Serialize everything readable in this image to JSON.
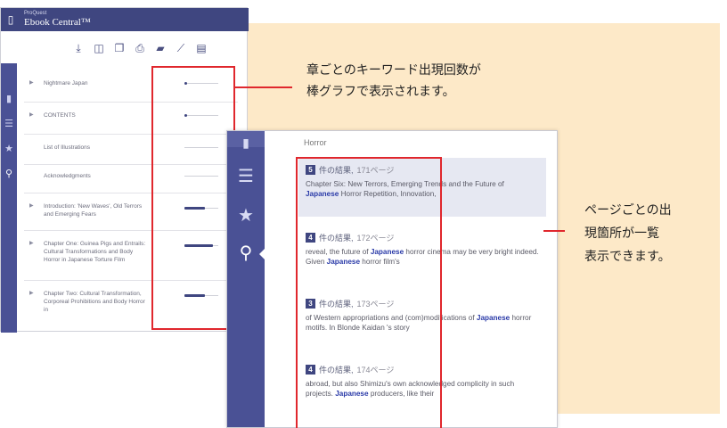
{
  "colors": {
    "accent": "#3f4680",
    "sidebar": "#4a5195",
    "highlight_red": "#e0272d",
    "panel_bg": "#fde9c8",
    "keyword": "#2a3aa8"
  },
  "back_window": {
    "brand_small": "ProQuest",
    "brand": "Ebook Central™",
    "toolbar": [
      "download-icon",
      "book-icon",
      "copy-icon",
      "print-icon",
      "bookmark-icon",
      "link-icon",
      "note-icon"
    ],
    "sidebar_icons": [
      "contents-icon",
      "list-icon",
      "star-icon",
      "search-icon"
    ],
    "rows": [
      {
        "label": "Nightmare Japan",
        "arrow": "▶",
        "bar": "dot"
      },
      {
        "label": "CONTENTS",
        "arrow": "▶",
        "bar": "dot"
      },
      {
        "label": "List of Illustrations",
        "arrow": "",
        "bar": "none"
      },
      {
        "label": "Acknowledgments",
        "arrow": "",
        "bar": "none"
      },
      {
        "label": "Introduction: 'New Waves', Old Terrors and Emerging Fears",
        "arrow": "▶",
        "bar": 0.6
      },
      {
        "label": "Chapter One: Guinea Pigs and Entrails: Cultural Transformations and Body Horror in Japanese Torture Film",
        "arrow": "▶",
        "bar": 0.85
      },
      {
        "label": "Chapter Two: Cultural Transformation, Corporeal Prohibitions and Body Horror in",
        "arrow": "▶",
        "bar": 0.6
      }
    ]
  },
  "front_window": {
    "heading": "Horror",
    "sidebar_icons": [
      "contents-icon",
      "list-icon",
      "star-icon",
      "search-icon"
    ],
    "results": [
      {
        "num": "5",
        "count": "件の結果,",
        "page": "171ページ",
        "selected": true,
        "text_pre": "Chapter Six: New Terrors, Emerging Trends and the Future of ",
        "keyword": "Japanese",
        "text_post": " Horror Repetition, Innovation,"
      },
      {
        "num": "4",
        "count": "件の結果,",
        "page": "172ページ",
        "selected": false,
        "text_pre": "reveal, the future of ",
        "keyword": "Japanese",
        "text_post": " horror cinema may be very bright indeed. Given ",
        "keyword2": "Japanese",
        "text_post2": " horror film's"
      },
      {
        "num": "3",
        "count": "件の結果,",
        "page": "173ページ",
        "selected": false,
        "text_pre": "of Western appropriations and (com)modifications of ",
        "keyword": "Japanese",
        "text_post": " horror motifs. In Blonde Kaidan 's story"
      },
      {
        "num": "4",
        "count": "件の結果,",
        "page": "174ページ",
        "selected": false,
        "text_pre": "abroad, but also Shimizu's own acknowledged complicity in such projects. ",
        "keyword": "Japanese",
        "text_post": " producers, like their"
      }
    ]
  },
  "callouts": {
    "chapter_bar": [
      "章ごとのキーワード出現回数が",
      "棒グラフで表示されます。"
    ],
    "page_list": [
      "ページごとの出",
      "現箇所が一覧",
      "表示できます。"
    ]
  }
}
